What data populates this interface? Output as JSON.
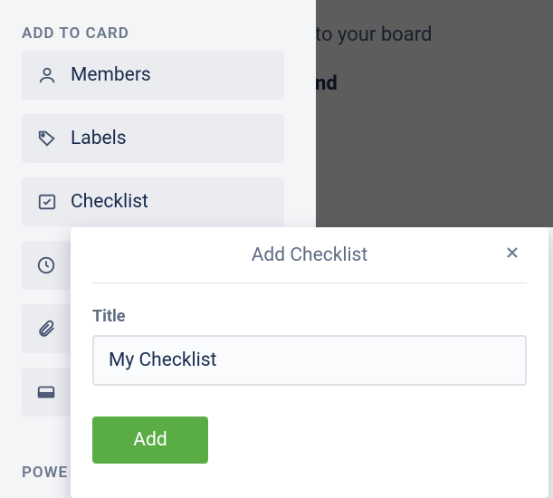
{
  "section_title": "ADD TO CARD",
  "buttons": {
    "members": "Members",
    "labels": "Labels",
    "checklist": "Checklist"
  },
  "background": {
    "line1": " to your board",
    "line2": "nd"
  },
  "power_section": "POWE",
  "popover": {
    "title": "Add Checklist",
    "field_label": "Title",
    "input_value": "My Checklist",
    "submit_label": "Add"
  }
}
